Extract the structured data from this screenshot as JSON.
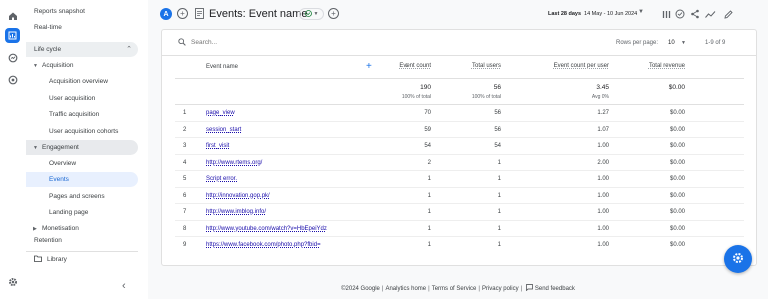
{
  "rail": {
    "icons": [
      "home-icon",
      "reports-icon",
      "explore-icon",
      "advertising-icon",
      "settings-icon"
    ]
  },
  "sidebar": {
    "reports_snapshot": "Reports snapshot",
    "realtime": "Real-time",
    "lifecycle": "Life cycle",
    "acquisition": "Acquisition",
    "acquisition_overview": "Acquisition overview",
    "user_acquisition": "User acquisition",
    "traffic_acquisition": "Traffic acquisition",
    "user_acquisition_cohorts": "User acquisition cohorts",
    "engagement": "Engagement",
    "overview": "Overview",
    "events": "Events",
    "pages_and_screens": "Pages and screens",
    "landing_page": "Landing page",
    "monetisation": "Monetisation",
    "retention": "Retention",
    "library": "Library"
  },
  "topbar": {
    "avatar_letter": "A",
    "title": "Events: Event name",
    "date_range_label": "Last 28 days",
    "date_range": "14 May - 10 Jun 2024"
  },
  "table": {
    "search_placeholder": "Search...",
    "rows_per_page_label": "Rows per page:",
    "rows_per_page": "10",
    "range_text": "1-9 of 9",
    "headers": {
      "name": "Event name",
      "event_count": "Event count",
      "total_users": "Total users",
      "per_user": "Event count per user",
      "revenue": "Total revenue"
    },
    "totals": {
      "event_count": "190",
      "event_count_sub": "100% of total",
      "total_users": "56",
      "total_users_sub": "100% of total",
      "per_user": "3.45",
      "per_user_sub": "Avg 0%",
      "revenue": "$0.00"
    },
    "rows": [
      {
        "idx": "1",
        "name": "page_view",
        "event_count": "70",
        "users": "56",
        "per_user": "1.27",
        "revenue": "$0.00"
      },
      {
        "idx": "2",
        "name": "session_start",
        "event_count": "59",
        "users": "56",
        "per_user": "1.07",
        "revenue": "$0.00"
      },
      {
        "idx": "3",
        "name": "first_visit",
        "event_count": "54",
        "users": "54",
        "per_user": "1.00",
        "revenue": "$0.00"
      },
      {
        "idx": "4",
        "name": "http://www.rtems.org/",
        "event_count": "2",
        "users": "1",
        "per_user": "2.00",
        "revenue": "$0.00"
      },
      {
        "idx": "5",
        "name": "Script error.",
        "event_count": "1",
        "users": "1",
        "per_user": "1.00",
        "revenue": "$0.00"
      },
      {
        "idx": "6",
        "name": "http://innovation.gop.pk/",
        "event_count": "1",
        "users": "1",
        "per_user": "1.00",
        "revenue": "$0.00"
      },
      {
        "idx": "7",
        "name": "http://www.imblog.info/",
        "event_count": "1",
        "users": "1",
        "per_user": "1.00",
        "revenue": "$0.00"
      },
      {
        "idx": "8",
        "name": "http://www.youtube.com/watch?v=HbEpeiYdz",
        "event_count": "1",
        "users": "1",
        "per_user": "1.00",
        "revenue": "$0.00"
      },
      {
        "idx": "9",
        "name": "https://www.facebook.com/photo.php?fbid=",
        "event_count": "1",
        "users": "1",
        "per_user": "1.00",
        "revenue": "$0.00"
      }
    ]
  },
  "footer": {
    "copyright": "©2024 Google",
    "analytics_home": "Analytics home",
    "terms": "Terms of Service",
    "privacy": "Privacy policy",
    "feedback": "Send feedback"
  },
  "colors": {
    "accent": "#1a73e8",
    "link": "#1a0dab",
    "selected_bg": "#e8f0fe"
  }
}
